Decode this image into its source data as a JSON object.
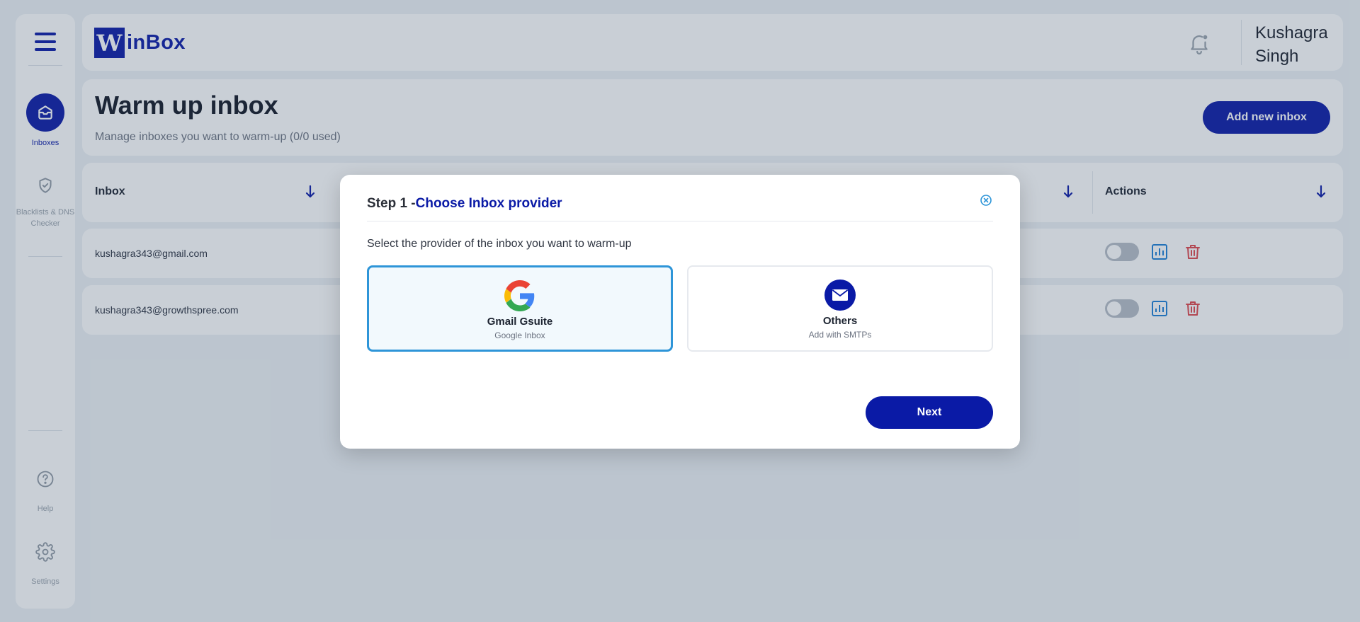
{
  "brand": {
    "logo_letter": "W",
    "logo_text": "inBox"
  },
  "sidebar": {
    "items": [
      {
        "label": "Inboxes",
        "icon": "inbox-icon",
        "active": true
      },
      {
        "label": "Blacklists & DNS Checker",
        "icon": "shield-check-icon",
        "active": false
      },
      {
        "label": "Help",
        "icon": "help-circle-icon",
        "active": false
      },
      {
        "label": "Settings",
        "icon": "gear-icon",
        "active": false
      }
    ]
  },
  "topbar": {
    "user_name": "Kushagra Singh",
    "notification_icon": "bell-icon"
  },
  "header": {
    "title": "Warm up inbox",
    "subtitle": "Manage inboxes you want to warm-up (0/0 used)",
    "add_button": "Add new inbox"
  },
  "table": {
    "columns": [
      "Inbox",
      "Actions"
    ],
    "rows": [
      {
        "email": "kushagra343@gmail.com",
        "enabled": false
      },
      {
        "email": "kushagra343@growthspree.com",
        "enabled": false
      }
    ]
  },
  "modal": {
    "step": "Step 1 -",
    "title": "Choose Inbox provider",
    "description": "Select the provider of the inbox you want to warm-up",
    "providers": [
      {
        "name": "Gmail Gsuite",
        "sub": "Google Inbox",
        "icon": "google-icon",
        "selected": true
      },
      {
        "name": "Others",
        "sub": "Add with SMTPs",
        "icon": "envelope-icon",
        "selected": false
      }
    ],
    "next_button": "Next"
  },
  "colors": {
    "brand": "#0a1aa6",
    "selected_border": "#2e95d8",
    "action_blue": "#1b7fd6",
    "delete_red": "#e0474c",
    "toggle_off": "#b7bec7"
  }
}
